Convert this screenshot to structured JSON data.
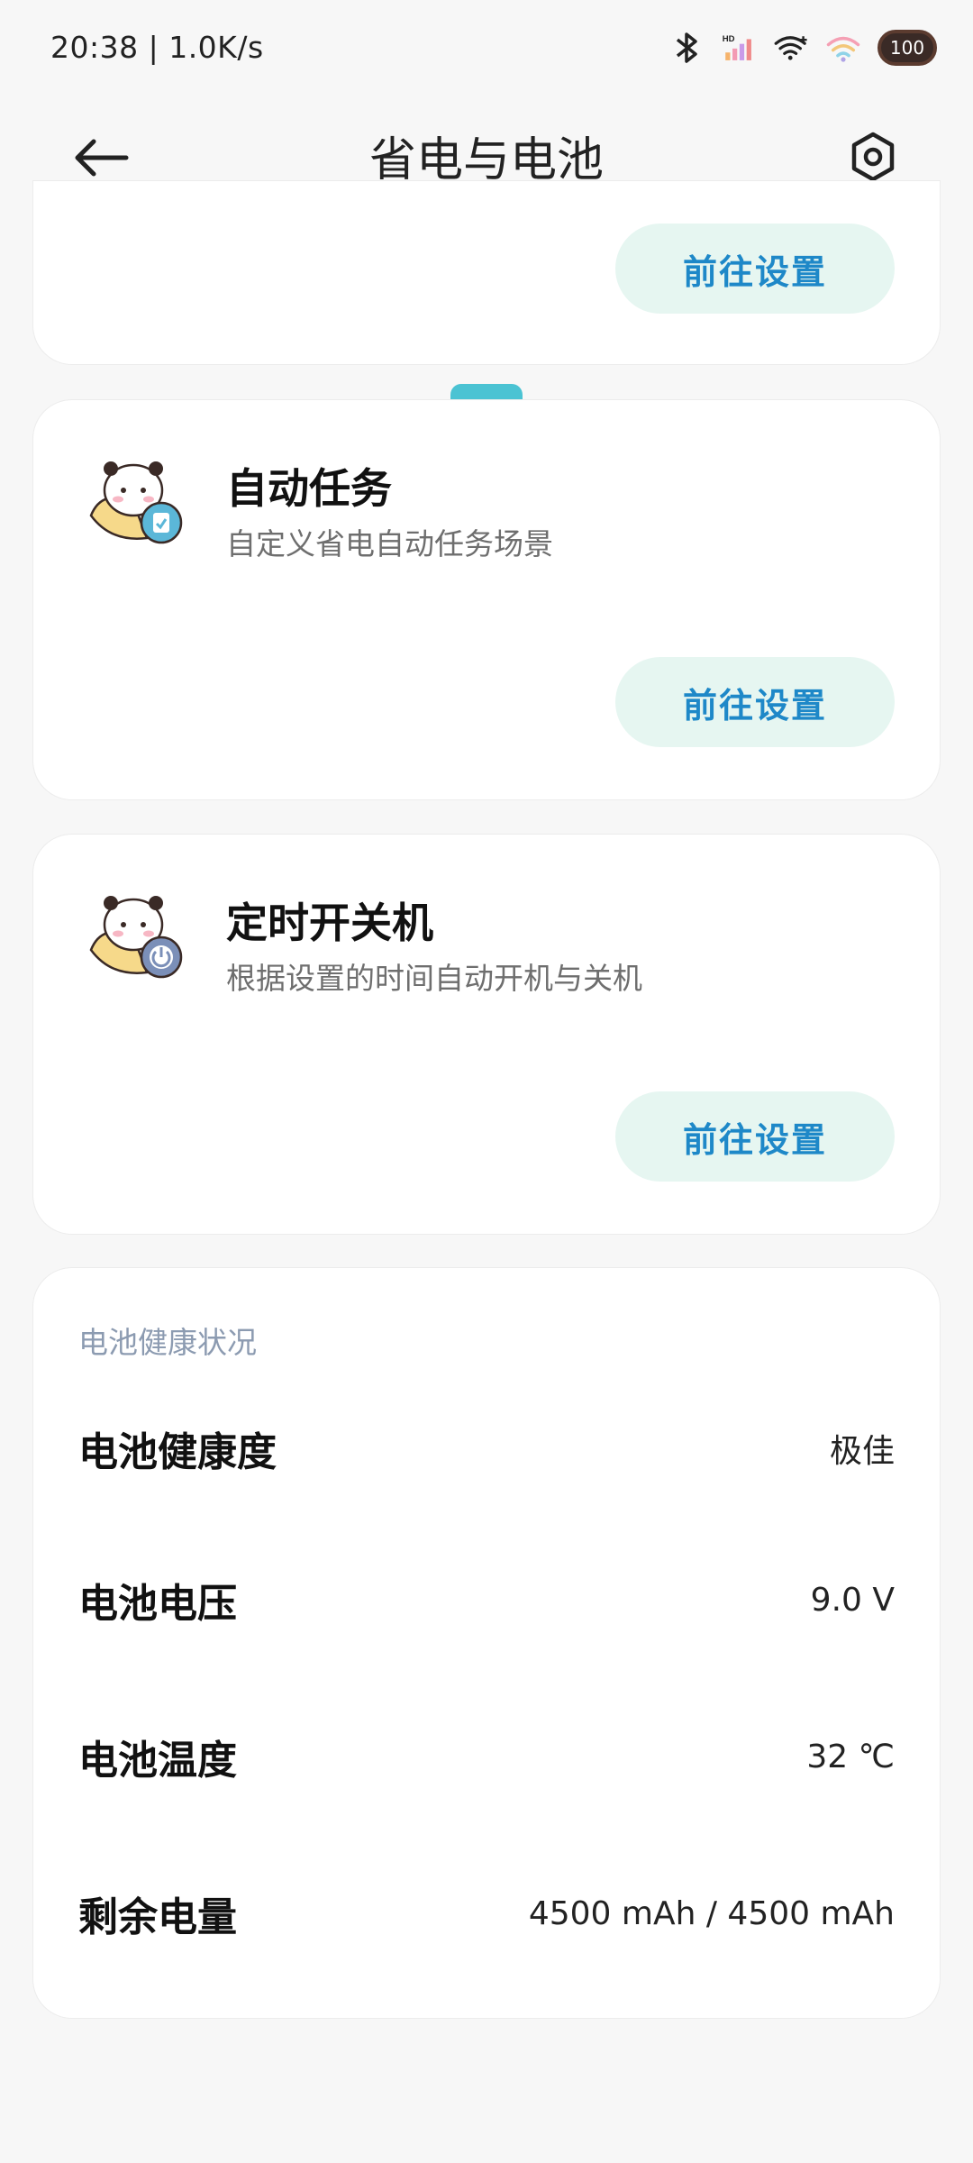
{
  "status_bar": {
    "time_speed": "20:38 | 1.0K/s",
    "battery_level": "100",
    "icons": [
      "bluetooth-icon",
      "signal-hd-icon",
      "wifi-icon",
      "wifi-secondary-icon",
      "battery-icon"
    ]
  },
  "header": {
    "title": "省电与电池",
    "back_icon": "arrow-left-icon",
    "settings_icon": "settings-gear-icon"
  },
  "top_card": {
    "button_label": "前往设置"
  },
  "features": [
    {
      "title": "自动任务",
      "description": "自定义省电自动任务场景",
      "button_label": "前往设置",
      "icon": "panda-clipboard-icon"
    },
    {
      "title": "定时开关机",
      "description": "根据设置的时间自动开机与关机",
      "button_label": "前往设置",
      "icon": "panda-power-icon"
    }
  ],
  "battery_health": {
    "section_title": "电池健康状况",
    "rows": [
      {
        "label": "电池健康度",
        "value": "极佳"
      },
      {
        "label": "电池电压",
        "value": "9.0 V"
      },
      {
        "label": "电池温度",
        "value": "32 ℃"
      },
      {
        "label": "剩余电量",
        "value": "4500 mAh / 4500 mAh"
      }
    ]
  },
  "colors": {
    "accent_text": "#1e88c8",
    "button_bg": "#e6f6f1",
    "section_label": "#8c9bb1",
    "page_bg": "#f7f7f7"
  }
}
